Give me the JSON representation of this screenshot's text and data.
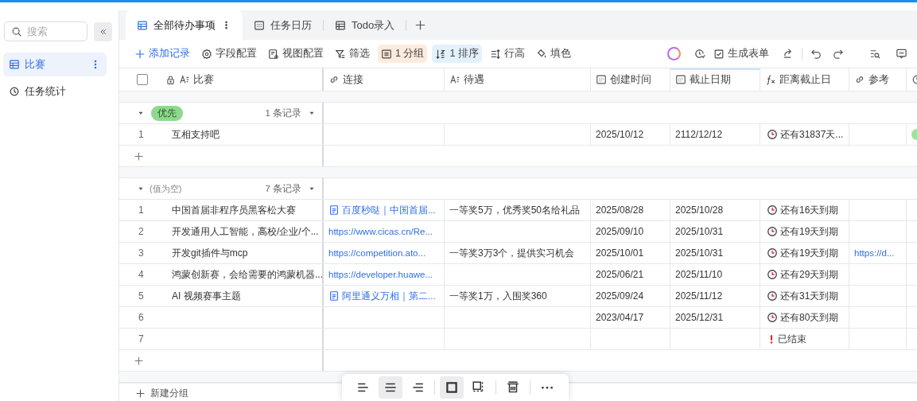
{
  "sidebar": {
    "search": {
      "placeholder": "搜索"
    },
    "items": [
      {
        "label": "比赛",
        "kind": "table",
        "selected": true
      },
      {
        "label": "任务统计",
        "kind": "dashboard",
        "selected": false
      }
    ]
  },
  "tabs": [
    {
      "label": "全部待办事项",
      "kind": "grid",
      "selected": true
    },
    {
      "label": "任务日历",
      "kind": "calendar",
      "selected": false
    },
    {
      "label": "Todo录入",
      "kind": "grid",
      "selected": false
    }
  ],
  "toolbar": {
    "left": [
      {
        "label": "添加记录",
        "kind": "primary"
      },
      {
        "label": "字段配置",
        "kind": "plain"
      },
      {
        "label": "视图配置",
        "kind": "plain"
      },
      {
        "label": "筛选",
        "kind": "plain"
      },
      {
        "label": "1 分组",
        "kind": "active",
        "color": "#fdebdd"
      },
      {
        "label": "1 排序",
        "kind": "active",
        "color": "#e3f1fb"
      },
      {
        "label": "行高",
        "kind": "plain"
      },
      {
        "label": "填色",
        "kind": "plain"
      }
    ],
    "form_button": "生成表单"
  },
  "table": {
    "select_all": {
      "checked": false
    },
    "columns": [
      {
        "label": "比赛",
        "kind": "text",
        "selected": false
      },
      {
        "label": "连接",
        "kind": "link",
        "selected": false
      },
      {
        "label": "待遇",
        "kind": "text",
        "selected": false
      },
      {
        "label": "创建时间",
        "kind": "date",
        "selected": false
      },
      {
        "label": "截止日期",
        "kind": "date",
        "selected": true
      },
      {
        "label": "距离截止日",
        "kind": "formula",
        "selected": false
      },
      {
        "label": "参考",
        "kind": "link",
        "selected": false
      }
    ],
    "groups": [
      {
        "kind": "tag",
        "label": "优先",
        "color": "#8fd98f",
        "count": "1 条记录",
        "rows": [
          {
            "index": "1",
            "name": "互相支持吧",
            "created": "2025/10/12",
            "due": "2112/12/12",
            "countdown": {
              "kind": "clock",
              "text": "还有31837天..."
            },
            "color": "#9be39b"
          }
        ]
      },
      {
        "kind": "empty",
        "label": "(值为空)",
        "count": "7 条记录",
        "rows": [
          {
            "index": "1",
            "name": "中国首届非程序员黑客松大赛",
            "link": {
              "kind": "doc",
              "text": "百度秒哒｜中国首届..."
            },
            "reward": "一等奖5万，优秀奖50名给礼品",
            "created": "2025/08/28",
            "due": "2025/10/28",
            "countdown": {
              "kind": "clock",
              "text": "还有16天到期"
            }
          },
          {
            "index": "2",
            "name": "开发通用人工智能，高校/企业/个...",
            "link": {
              "kind": "url",
              "text": "https://www.cicas.cn/Re..."
            },
            "created": "2025/09/10",
            "due": "2025/10/31",
            "countdown": {
              "kind": "clock",
              "text": "还有19天到期"
            }
          },
          {
            "index": "3",
            "name": "开发git插件与mcp",
            "link": {
              "kind": "url",
              "text": "https://competition.ato..."
            },
            "reward": "一等奖3万3个，提供实习机会",
            "created": "2025/10/01",
            "due": "2025/10/31",
            "countdown": {
              "kind": "clock",
              "text": "还有19天到期"
            },
            "reference": "https://d..."
          },
          {
            "index": "4",
            "name": "鸿蒙创新赛，会给需要的鸿蒙机器...",
            "link": {
              "kind": "url",
              "text": "https://developer.huawe..."
            },
            "created": "2025/06/21",
            "due": "2025/11/10",
            "countdown": {
              "kind": "clock",
              "text": "还有29天到期"
            }
          },
          {
            "index": "5",
            "name": "AI 视频赛事主题",
            "link": {
              "kind": "doc",
              "text": "阿里通义万相｜第二..."
            },
            "reward": "一等奖1万，入围奖360",
            "created": "2025/09/24",
            "due": "2025/11/12",
            "countdown": {
              "kind": "clock",
              "text": "还有31天到期"
            }
          },
          {
            "index": "6",
            "created": "2023/04/17",
            "due": "2025/12/31",
            "countdown": {
              "kind": "clock",
              "text": "还有80天到期"
            }
          },
          {
            "index": "7",
            "countdown": {
              "kind": "ended",
              "text": "已结束"
            }
          }
        ]
      }
    ],
    "new_group": "新建分组"
  },
  "floating_toolbar": [
    {
      "kind": "align-left",
      "selected": false
    },
    {
      "kind": "align-center",
      "selected": true
    },
    {
      "kind": "align-right",
      "selected": false
    },
    {
      "kind": "frame",
      "selected": true
    },
    {
      "kind": "scan",
      "selected": false
    },
    {
      "kind": "delete",
      "selected": false
    },
    {
      "kind": "more",
      "selected": false
    }
  ]
}
